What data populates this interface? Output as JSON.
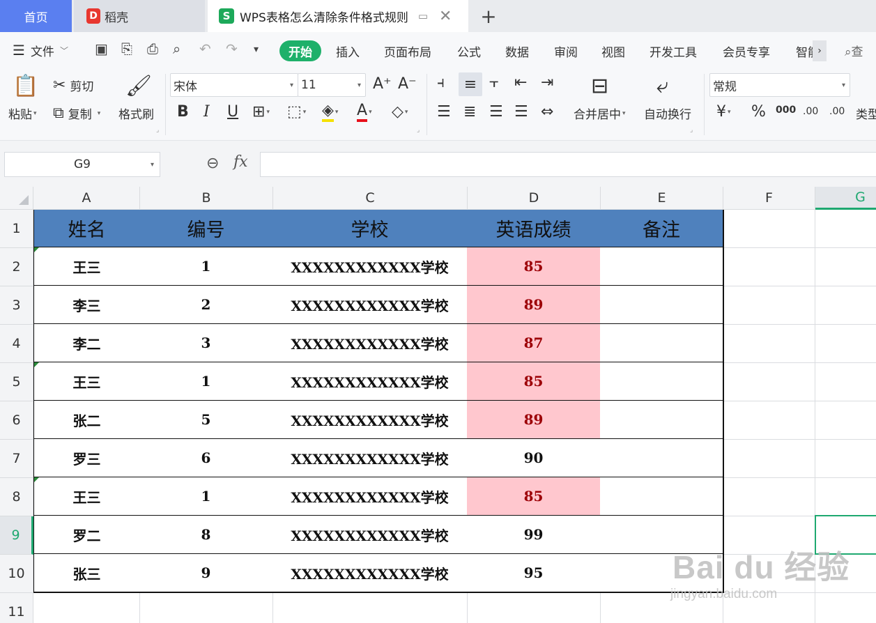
{
  "tabs": {
    "home": "首页",
    "daoke": "稻壳",
    "document": "WPS表格怎么清除条件格式规则"
  },
  "menu": {
    "file": "文件",
    "items": [
      "开始",
      "插入",
      "页面布局",
      "公式",
      "数据",
      "审阅",
      "视图",
      "开发工具",
      "会员专享",
      "智能"
    ],
    "search": "查"
  },
  "ribbon": {
    "paste": "粘贴",
    "cut": "剪切",
    "copy": "复制",
    "format_painter": "格式刷",
    "font_name": "宋体",
    "font_size": "11",
    "merge_center": "合并居中",
    "wrap_text": "自动换行",
    "number_format": "常规",
    "currency": "¥",
    "percent": "%",
    "thousands": "000",
    "inc_decimal": ".00",
    "dec_decimal": ".00",
    "type_label": "类型"
  },
  "formula_bar": {
    "name_box": "G9",
    "fx": "fx",
    "content": ""
  },
  "sheet": {
    "columns": [
      "A",
      "B",
      "C",
      "D",
      "E",
      "F",
      "G"
    ],
    "rows": [
      "1",
      "2",
      "3",
      "4",
      "5",
      "6",
      "7",
      "8",
      "9",
      "10",
      "11"
    ],
    "header": [
      "姓名",
      "编号",
      "学校",
      "英语成绩",
      "备注"
    ],
    "data": [
      [
        "王三",
        "1",
        "XXXXXXXXXXXX学校",
        "85",
        ""
      ],
      [
        "李三",
        "2",
        "XXXXXXXXXXXX学校",
        "89",
        ""
      ],
      [
        "李二",
        "3",
        "XXXXXXXXXXXX学校",
        "87",
        ""
      ],
      [
        "王三",
        "1",
        "XXXXXXXXXXXX学校",
        "85",
        ""
      ],
      [
        "张二",
        "5",
        "XXXXXXXXXXXX学校",
        "89",
        ""
      ],
      [
        "罗三",
        "6",
        "XXXXXXXXXXXX学校",
        "90",
        ""
      ],
      [
        "王三",
        "1",
        "XXXXXXXXXXXX学校",
        "85",
        ""
      ],
      [
        "罗二",
        "8",
        "XXXXXXXXXXXX学校",
        "99",
        ""
      ],
      [
        "张三",
        "9",
        "XXXXXXXXXXXX学校",
        "95",
        ""
      ]
    ],
    "highlighted_rows": [
      0,
      1,
      2,
      3,
      4,
      6
    ],
    "active_cell": "G9",
    "header_color": "#4f81bd",
    "highlight_fill": "#ffc7ce",
    "highlight_text": "#9c0006"
  },
  "watermark": {
    "main": "Bai du 经验",
    "sub": "jingyan.baidu.com"
  }
}
